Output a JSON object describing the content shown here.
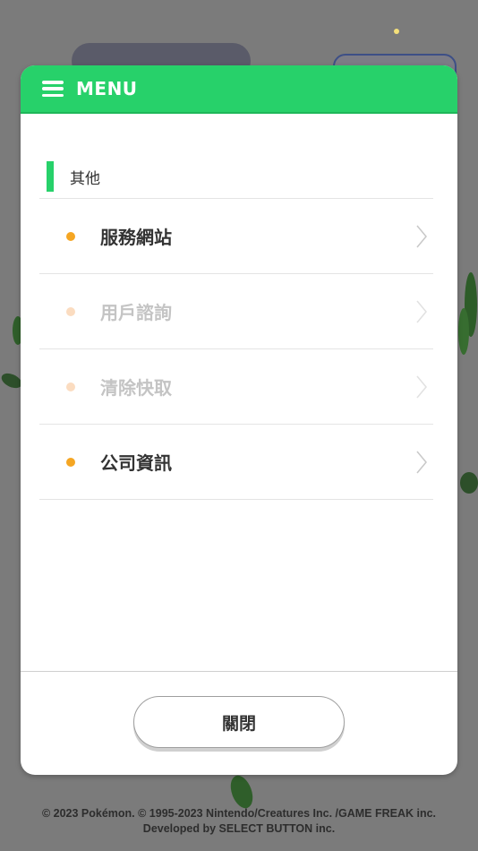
{
  "header": {
    "title": "MENU",
    "icon": "hamburger-menu-icon"
  },
  "section": {
    "title": "其他",
    "items": [
      {
        "label": "服務網站",
        "enabled": true
      },
      {
        "label": "用戶諮詢",
        "enabled": false
      },
      {
        "label": "清除快取",
        "enabled": false
      },
      {
        "label": "公司資訊",
        "enabled": true
      }
    ]
  },
  "footer_button": {
    "label": "關閉"
  },
  "copyright": {
    "line1": "© 2023 Pokémon. © 1995-2023 Nintendo/Creatures Inc. /GAME FREAK inc.",
    "line2": "Developed by SELECT BUTTON inc."
  },
  "colors": {
    "accent": "#27d16a",
    "bullet": "#f5a623",
    "overlay": "#7b7b7b"
  }
}
